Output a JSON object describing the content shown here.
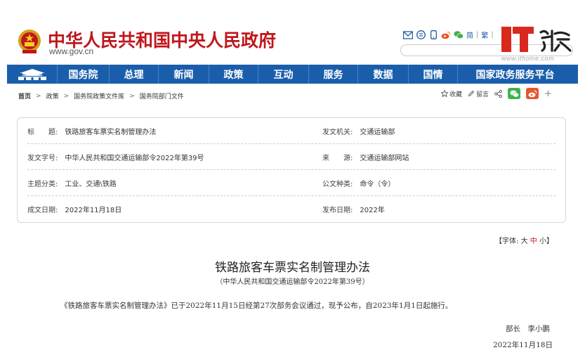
{
  "header": {
    "site_title": "中华人民共和国中央人民政府",
    "site_url": "www.gov.cn",
    "tools": {
      "simplified": "简",
      "traditional": "繁",
      "sep": "|"
    },
    "search": {
      "placeholder": ""
    }
  },
  "watermark": {
    "url": "www.ithome.com"
  },
  "nav": {
    "items": [
      {
        "label": "国务院"
      },
      {
        "label": "总理"
      },
      {
        "label": "新闻"
      },
      {
        "label": "政策"
      },
      {
        "label": "互动"
      },
      {
        "label": "服务"
      },
      {
        "label": "数据"
      },
      {
        "label": "国情"
      },
      {
        "label": "国家政务服务平台"
      }
    ]
  },
  "breadcrumb": {
    "items": [
      "首页",
      "政策",
      "国务院政策文件库",
      "国务院部门文件"
    ],
    "sep": ">"
  },
  "share": {
    "favorite": "收藏",
    "comment": "留言",
    "plus": "+"
  },
  "meta": {
    "title_label": "标　　题:",
    "title_value": "铁路旅客车票实名制管理办法",
    "issuer_label": "发文机关:",
    "issuer_value": "交通运输部",
    "docno_label": "发文字号:",
    "docno_value": "中华人民共和国交通运输部令2022年第39号",
    "source_label": "来　　源:",
    "source_value": "交通运输部网站",
    "topic_label": "主题分类:",
    "topic_value": "工业、交通\\铁路",
    "genre_label": "公文种类:",
    "genre_value": "命令（令）",
    "created_label": "成文日期:",
    "created_value": "2022年11月18日",
    "published_label": "发布日期:",
    "published_value": "2022年"
  },
  "fontsize": {
    "prefix": "【字体:",
    "large": "大",
    "medium": "中",
    "small": "小",
    "suffix": "】"
  },
  "article": {
    "title": "铁路旅客车票实名制管理办法",
    "subtitle": "（中华人民共和国交通运输部令2022年第39号）",
    "paragraph": "《铁路旅客车票实名制管理办法》已于2022年11月15日经第27次部务会议通过，现予公布，自2023年1月1日起施行。",
    "signer": "部长　李小鹏",
    "date": "2022年11月18日"
  },
  "colors": {
    "brand_red": "#c0161c",
    "nav_blue": "#1a5eab"
  }
}
